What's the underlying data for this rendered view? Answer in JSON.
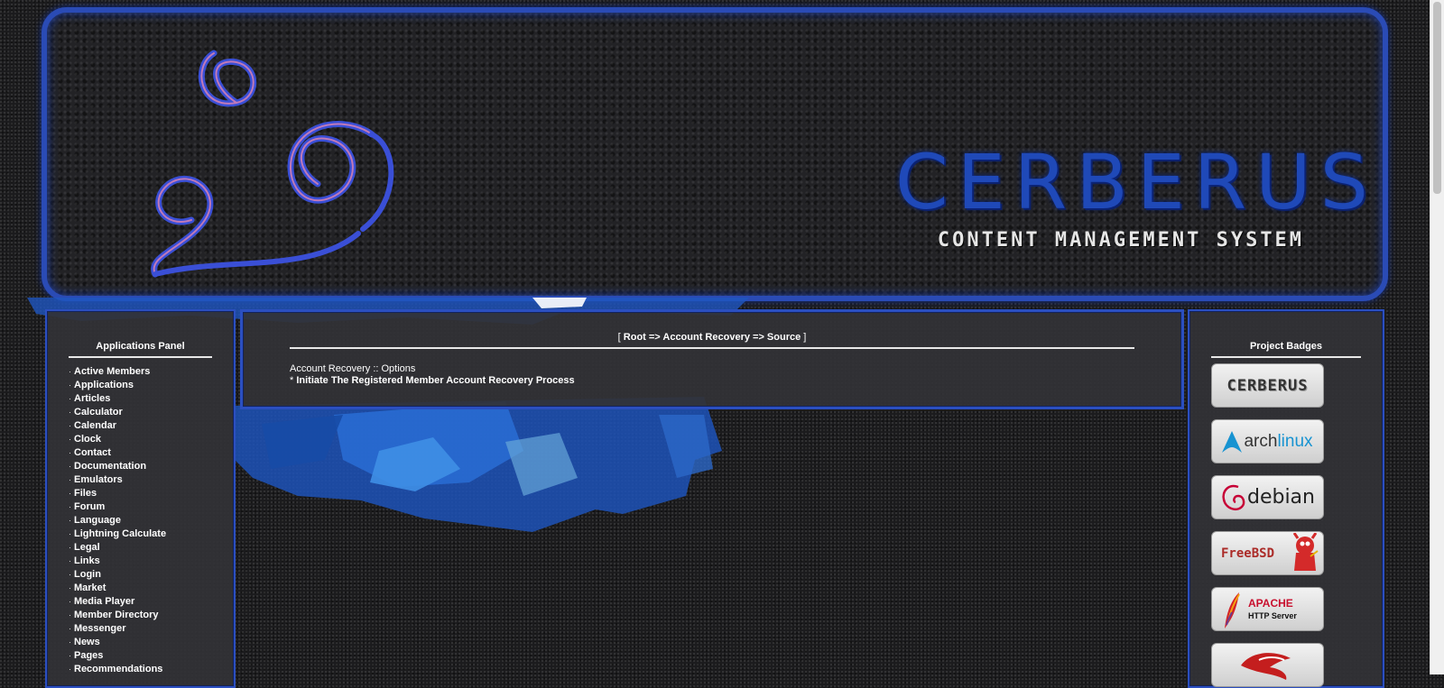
{
  "banner": {
    "title": "CERBERUS",
    "subtitle": "CONTENT MANAGEMENT SYSTEM"
  },
  "left_panel": {
    "title": "Applications Panel",
    "items": [
      {
        "label": "Active Members"
      },
      {
        "label": "Applications"
      },
      {
        "label": "Articles"
      },
      {
        "label": "Calculator"
      },
      {
        "label": "Calendar"
      },
      {
        "label": "Clock"
      },
      {
        "label": "Contact"
      },
      {
        "label": "Documentation"
      },
      {
        "label": "Emulators"
      },
      {
        "label": "Files"
      },
      {
        "label": "Forum"
      },
      {
        "label": "Language"
      },
      {
        "label": "Lightning Calculate"
      },
      {
        "label": "Legal"
      },
      {
        "label": "Links"
      },
      {
        "label": "Login"
      },
      {
        "label": "Market"
      },
      {
        "label": "Media Player"
      },
      {
        "label": "Member Directory"
      },
      {
        "label": "Messenger"
      },
      {
        "label": "News"
      },
      {
        "label": "Pages"
      },
      {
        "label": "Recommendations"
      }
    ]
  },
  "main": {
    "breadcrumb": "Root => Account Recovery => Source",
    "breadcrumb_open": "[",
    "breadcrumb_close": "]",
    "options_heading": "Account Recovery :: Options",
    "bullet": "*",
    "recovery_link": "Initiate The Registered Member Account Recovery Process"
  },
  "right_panel": {
    "title": "Project Badges",
    "badges": [
      {
        "name": "Cerberus",
        "text": "CERBERUS"
      },
      {
        "name": "Arch Linux",
        "text_a": "arch",
        "text_b": "linux"
      },
      {
        "name": "Debian",
        "text": "debian"
      },
      {
        "name": "FreeBSD",
        "text": "FreeBSD"
      },
      {
        "name": "Apache HTTP Server",
        "text_a": "APACHE",
        "text_b": "HTTP Server"
      },
      {
        "name": "NetBSD"
      }
    ]
  },
  "colors": {
    "accent_blue": "#2b4fc0",
    "panel_bg": "#323236",
    "page_bg": "#1b1b1d"
  }
}
